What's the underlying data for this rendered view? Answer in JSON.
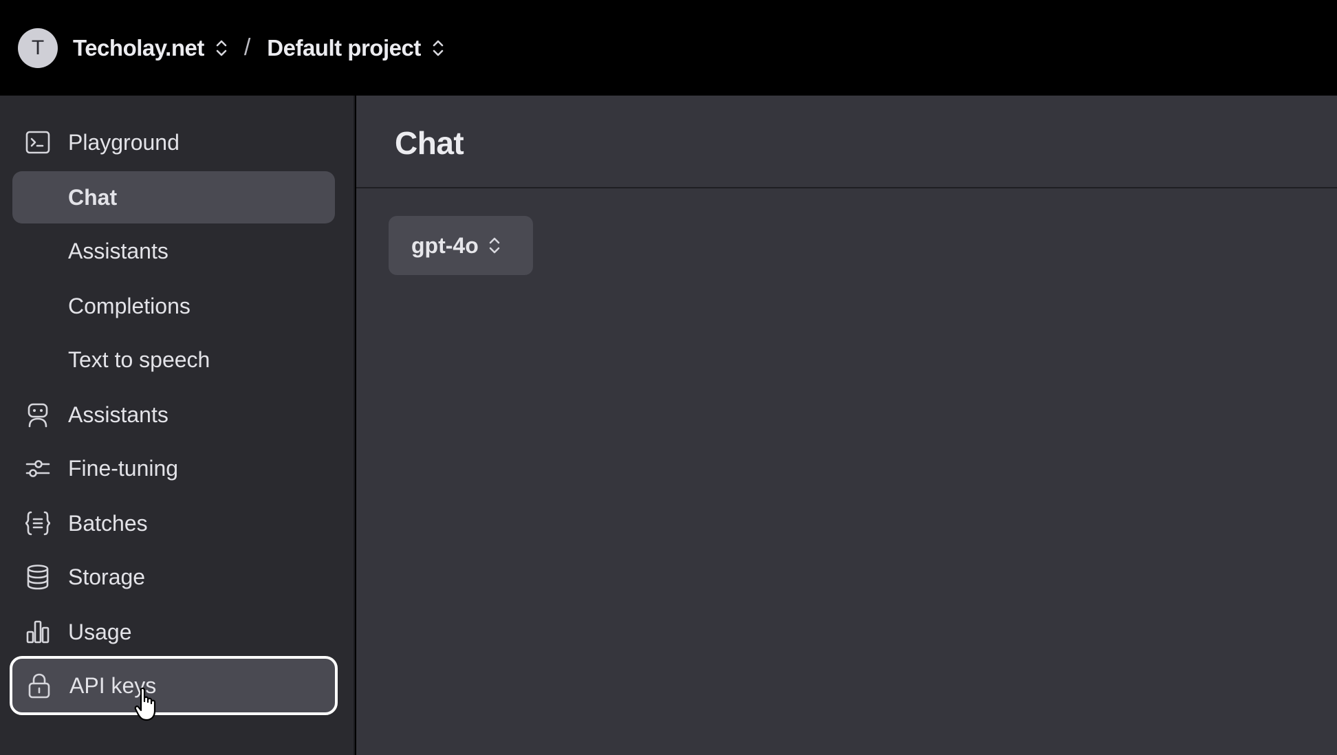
{
  "header": {
    "avatar_letter": "T",
    "org_name": "Techolay.net",
    "separator": "/",
    "project_name": "Default project"
  },
  "sidebar": {
    "items": [
      {
        "label": "Playground",
        "icon": "terminal-icon"
      },
      {
        "label": "Chat",
        "icon": "",
        "active": true
      },
      {
        "label": "Assistants",
        "icon": ""
      },
      {
        "label": "Completions",
        "icon": ""
      },
      {
        "label": "Text to speech",
        "icon": ""
      },
      {
        "label": "Assistants",
        "icon": "robot-icon"
      },
      {
        "label": "Fine-tuning",
        "icon": "sliders-icon"
      },
      {
        "label": "Batches",
        "icon": "braces-list-icon"
      },
      {
        "label": "Storage",
        "icon": "database-icon"
      },
      {
        "label": "Usage",
        "icon": "bar-chart-icon"
      },
      {
        "label": "API keys",
        "icon": "lock-icon",
        "highlighted": true
      }
    ]
  },
  "main": {
    "title": "Chat",
    "model_select": {
      "value": "gpt-4o"
    }
  },
  "colors": {
    "topbar_bg": "#000000",
    "sidebar_bg": "#2a2a2f",
    "main_bg": "#36363d",
    "active_item_bg": "#4a4a52",
    "highlight_border": "#ffffff",
    "text": "#e3e3e8"
  }
}
